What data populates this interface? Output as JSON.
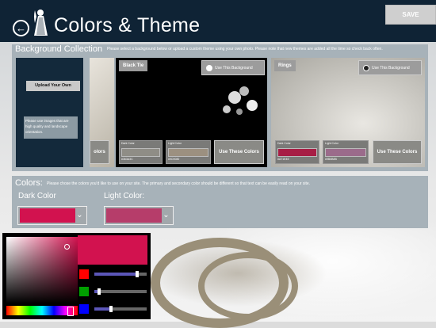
{
  "header": {
    "title": "Colors & Theme",
    "save_label": "SAVE"
  },
  "background_collection": {
    "title": "Background Collection",
    "description": "Please select a background below or upload a custom theme using your own photo. Please note that new themes are added all the time so check back often.",
    "upload_label": "Upload Your Own",
    "upload_note": "Please use images that are high quality and landscape orientation.",
    "cards": [
      {
        "name": "Black Tie",
        "use_background_label": "Use This Background",
        "selected": true,
        "dark_label": "Dark Color",
        "dark_hex": "#363A3C",
        "dark_color": "#8f8d86",
        "light_label": "Light Color",
        "light_hex": "#9C9080",
        "light_color": "#9c9080",
        "use_colors_label": "Use These Colors"
      },
      {
        "name": "Rings",
        "use_background_label": "Use This Background",
        "selected": false,
        "dark_label": "Dark Color",
        "dark_hex": "#A71E45",
        "dark_color": "#a71e45",
        "light_label": "Light Color",
        "light_hex": "#9B6B8B",
        "light_color": "#9b6b8b",
        "use_colors_label": "Use These Colors"
      }
    ]
  },
  "colors": {
    "title": "Colors:",
    "description": "Please chose the colors you'd like to use on your site. The primary and secondary color should be different so that text can be easily read on your site.",
    "dark_label": "Dark Color",
    "dark_value": "#d2124f",
    "light_label": "Light Color:",
    "light_value": "#b63d6a"
  },
  "picker": {
    "preview_color": "#d2124f",
    "red": 0.82,
    "green": 0.07,
    "blue": 0.31,
    "hue": 0.94
  },
  "icons": [
    "back-arrow-icon",
    "bride-logo-icon",
    "chevron-down-icon"
  ]
}
